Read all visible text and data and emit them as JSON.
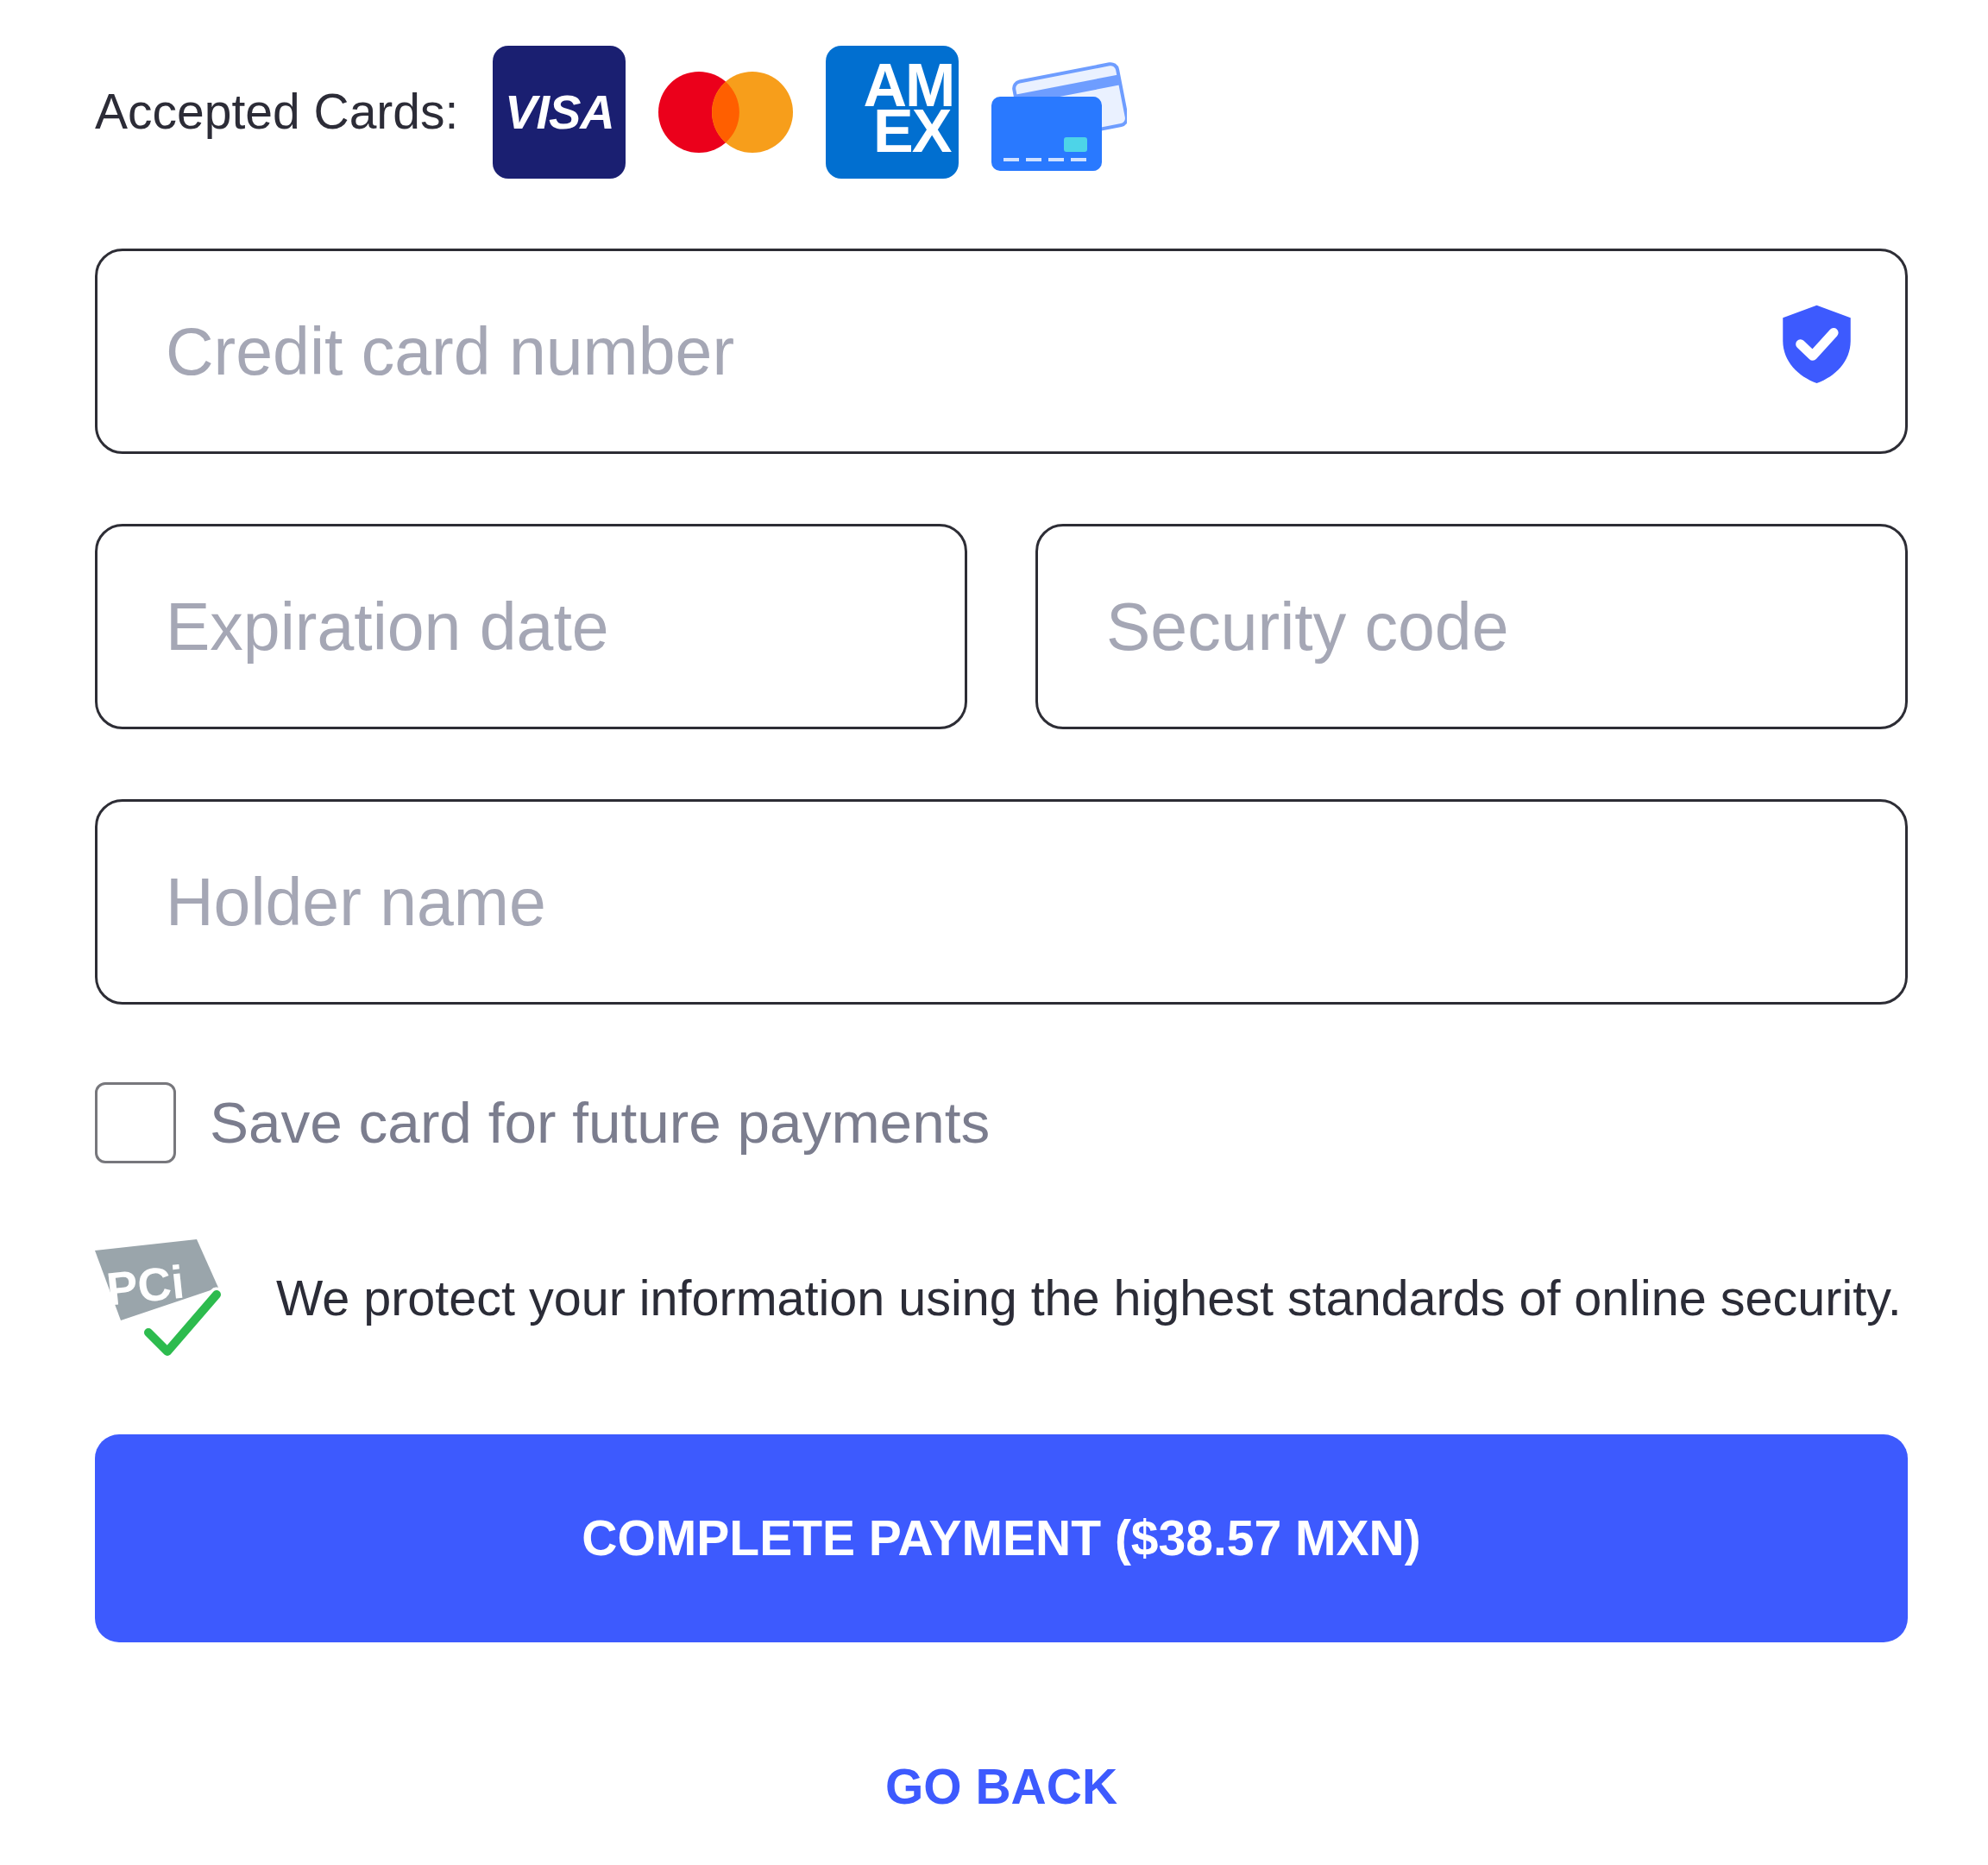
{
  "accepted_cards": {
    "label": "Accepted Cards:",
    "cards": [
      {
        "kind": "visa",
        "lines": [
          "VISA"
        ]
      },
      {
        "kind": "mastercard"
      },
      {
        "kind": "amex",
        "lines": [
          "AM",
          "EX"
        ]
      },
      {
        "kind": "generic"
      }
    ]
  },
  "form_rows": [
    {
      "fields": [
        {
          "placeholder": "Credit card number",
          "verified": true
        }
      ]
    },
    {
      "fields": [
        {
          "placeholder": "Expiration date",
          "verified": false
        },
        {
          "placeholder": "Security code",
          "verified": false
        }
      ]
    },
    {
      "fields": [
        {
          "placeholder": "Holder name",
          "verified": false
        }
      ]
    }
  ],
  "save_card": {
    "label": "Save card for future payments",
    "checked": false
  },
  "security_note": {
    "badge_text": "PCi",
    "text": "We protect your information using the highest standards of online security."
  },
  "pay_button": {
    "label": "COMPLETE PAYMENT ($38.57 MXN)"
  },
  "back_link": {
    "label": "GO BACK"
  }
}
